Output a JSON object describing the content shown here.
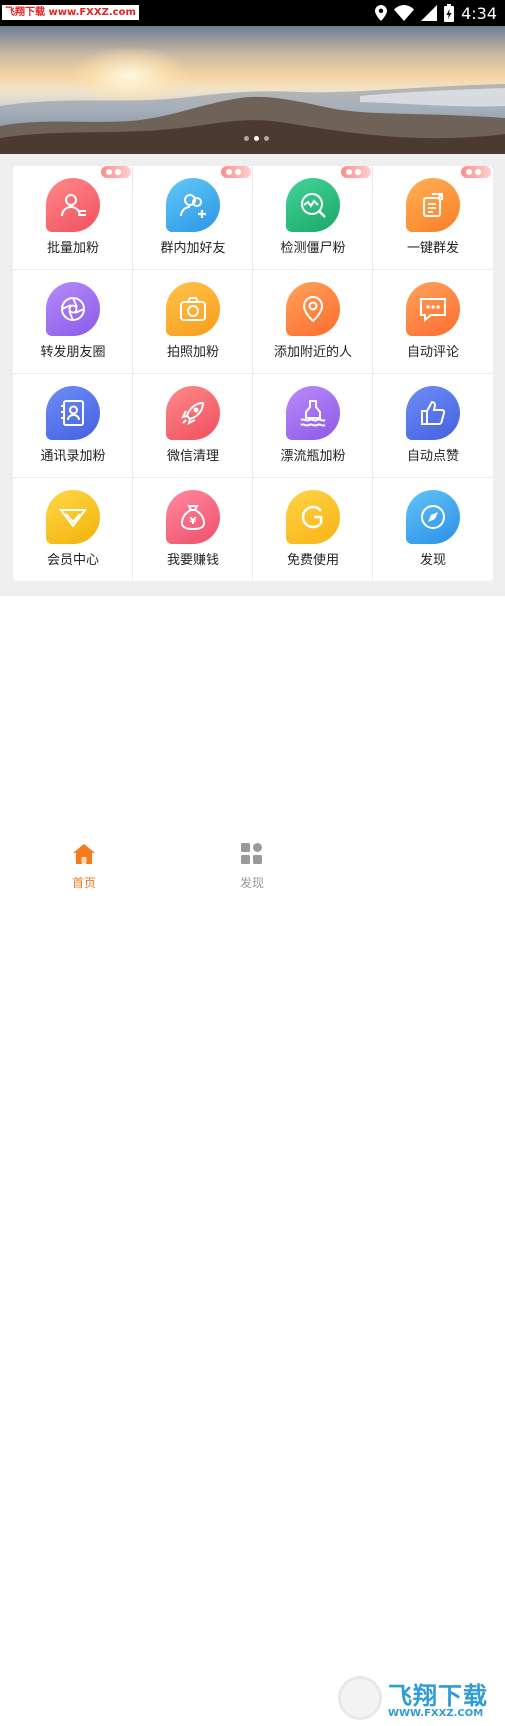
{
  "status_bar": {
    "watermark": "飞翔下载 www.FXXZ.com",
    "time": "4:34"
  },
  "banner": {
    "dots": 3,
    "active_dot": 1
  },
  "grid": [
    {
      "label": "批量加粉",
      "icon": "add-contact-icon",
      "color1": "#ff8a8a",
      "color2": "#f0505f",
      "badge": true
    },
    {
      "label": "群内加好友",
      "icon": "group-add-icon",
      "color1": "#63c9f7",
      "color2": "#2a95e6",
      "badge": true
    },
    {
      "label": "检测僵尸粉",
      "icon": "detect-icon",
      "color1": "#44d39a",
      "color2": "#1aa867",
      "badge": true
    },
    {
      "label": "一键群发",
      "icon": "send-icon",
      "color1": "#ffb158",
      "color2": "#fb7e25",
      "badge": true
    },
    {
      "label": "转发朋友圈",
      "icon": "camera-aperture-icon",
      "color1": "#b58cfa",
      "color2": "#8a5ae8",
      "badge": false
    },
    {
      "label": "拍照加粉",
      "icon": "camera-icon",
      "color1": "#ffc34a",
      "color2": "#f89c1a",
      "badge": false
    },
    {
      "label": "添加附近的人",
      "icon": "location-icon",
      "color1": "#ffa25a",
      "color2": "#fb6b2e",
      "badge": false
    },
    {
      "label": "自动评论",
      "icon": "comment-icon",
      "color1": "#ffa35c",
      "color2": "#fb6c30",
      "badge": false
    },
    {
      "label": "通讯录加粉",
      "icon": "contacts-book-icon",
      "color1": "#6f8cf7",
      "color2": "#4461e0",
      "badge": false
    },
    {
      "label": "微信清理",
      "icon": "rocket-icon",
      "color1": "#ff8a8a",
      "color2": "#ee4f5e",
      "badge": false
    },
    {
      "label": "漂流瓶加粉",
      "icon": "bottle-icon",
      "color1": "#b98cfa",
      "color2": "#8b58e6",
      "badge": false
    },
    {
      "label": "自动点赞",
      "icon": "thumbs-up-icon",
      "color1": "#6f8cf7",
      "color2": "#4461e0",
      "badge": false
    },
    {
      "label": "会员中心",
      "icon": "vip-icon",
      "color1": "#ffd847",
      "color2": "#f2b10a",
      "badge": false
    },
    {
      "label": "我要赚钱",
      "icon": "money-bag-icon",
      "color1": "#ff8aa0",
      "color2": "#ee4f6a",
      "badge": false
    },
    {
      "label": "免费使用",
      "icon": "free-g-icon",
      "color1": "#ffd447",
      "color2": "#f8b214",
      "badge": false
    },
    {
      "label": "发现",
      "icon": "compass-icon",
      "color1": "#63c4f7",
      "color2": "#2a8fe6",
      "badge": false
    }
  ],
  "tabbar": {
    "home_label": "首页",
    "discover_label": "发现",
    "active_color": "#f37b1d",
    "inactive_color": "#999999"
  },
  "watermark_bottom": {
    "big": "飞翔下载",
    "url": "WWW.FXXZ.COM"
  }
}
